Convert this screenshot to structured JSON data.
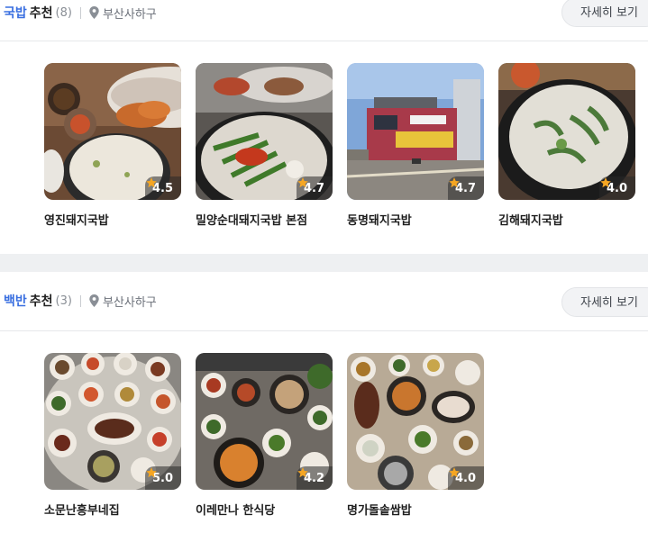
{
  "sections": [
    {
      "category": "국밥",
      "suffix": "추천",
      "count": "(8)",
      "location": "부산사하구",
      "detail_label": "자세히 보기",
      "cards": [
        {
          "name": "영진돼지국밥",
          "rating": "4.5"
        },
        {
          "name": "밀양순대돼지국밥 본점",
          "rating": "4.7"
        },
        {
          "name": "동명돼지국밥",
          "rating": "4.7"
        },
        {
          "name": "김해돼지국밥",
          "rating": "4.0"
        }
      ]
    },
    {
      "category": "백반",
      "suffix": "추천",
      "count": "(3)",
      "location": "부산사하구",
      "detail_label": "자세히 보기",
      "cards": [
        {
          "name": "소문난흥부네집",
          "rating": "5.0"
        },
        {
          "name": "이레만나 한식당",
          "rating": "4.2"
        },
        {
          "name": "명가돌솥쌈밥",
          "rating": "4.0"
        }
      ]
    }
  ],
  "colors": {
    "category": "#3a6fe0",
    "star": "#f5a623"
  },
  "icons": {
    "location": "map-pin-icon",
    "rating": "star-icon"
  }
}
